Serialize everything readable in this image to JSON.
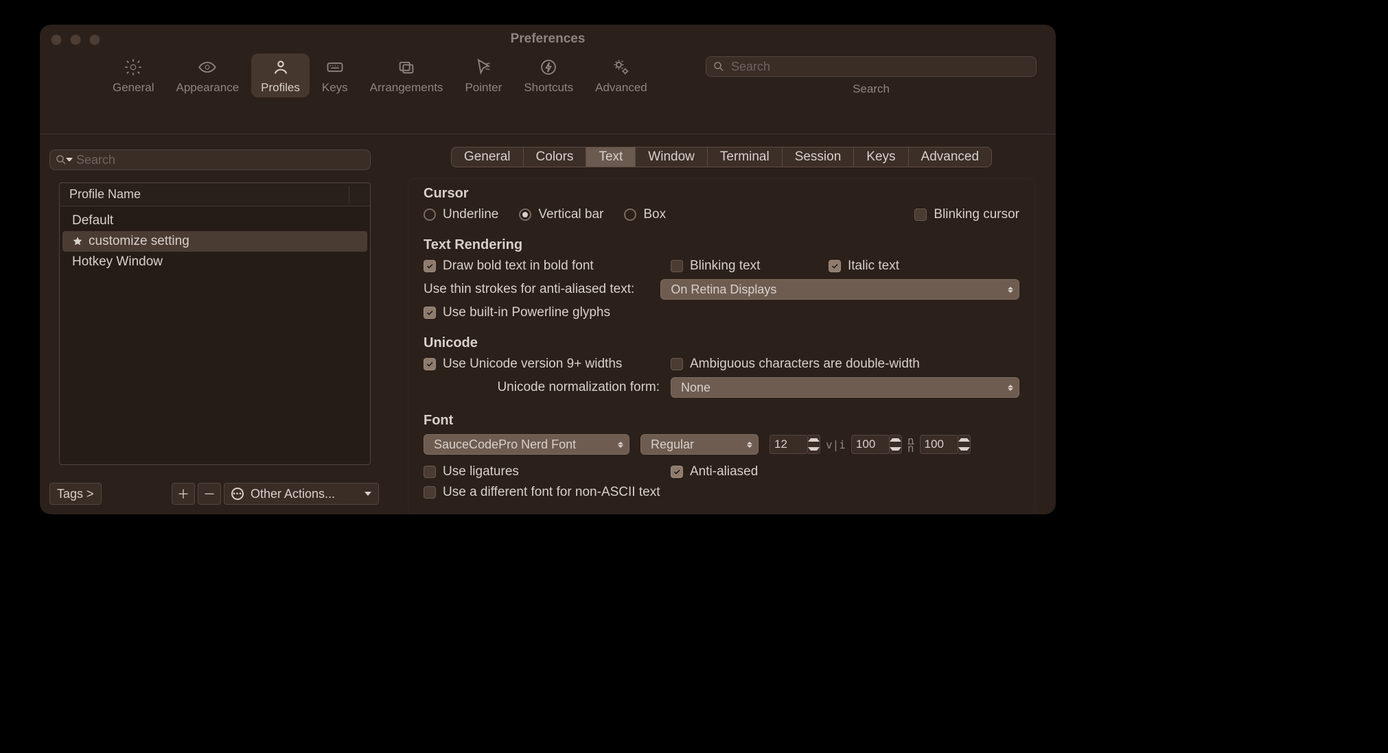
{
  "window": {
    "title": "Preferences"
  },
  "toolbar": {
    "items": [
      {
        "label": "General"
      },
      {
        "label": "Appearance"
      },
      {
        "label": "Profiles"
      },
      {
        "label": "Keys"
      },
      {
        "label": "Arrangements"
      },
      {
        "label": "Pointer"
      },
      {
        "label": "Shortcuts"
      },
      {
        "label": "Advanced"
      }
    ],
    "selected_index": 2,
    "search_placeholder": "Search",
    "search_caption": "Search"
  },
  "sidebar": {
    "search_placeholder": "Search",
    "header": "Profile Name",
    "profiles": [
      {
        "name": "Default",
        "default": false,
        "selected": false
      },
      {
        "name": "customize setting",
        "default": true,
        "selected": true
      },
      {
        "name": "Hotkey Window",
        "default": false,
        "selected": false
      }
    ],
    "tags_label": "Tags >",
    "other_actions_label": "Other Actions..."
  },
  "detail": {
    "tabs": [
      "General",
      "Colors",
      "Text",
      "Window",
      "Terminal",
      "Session",
      "Keys",
      "Advanced"
    ],
    "selected_tab_index": 2,
    "cursor": {
      "heading": "Cursor",
      "options": [
        "Underline",
        "Vertical bar",
        "Box"
      ],
      "selected_index": 1,
      "blinking_label": "Blinking cursor",
      "blinking_checked": false
    },
    "text_rendering": {
      "heading": "Text Rendering",
      "bold_label": "Draw bold text in bold font",
      "bold_checked": true,
      "blinking_text_label": "Blinking text",
      "blinking_text_checked": false,
      "italic_label": "Italic text",
      "italic_checked": true,
      "thin_strokes_label": "Use thin strokes for anti-aliased text:",
      "thin_strokes_value": "On Retina Displays",
      "powerline_label": "Use built-in Powerline glyphs",
      "powerline_checked": true
    },
    "unicode": {
      "heading": "Unicode",
      "v9_label": "Use Unicode version 9+ widths",
      "v9_checked": true,
      "ambiguous_label": "Ambiguous characters are double-width",
      "ambiguous_checked": false,
      "norm_label": "Unicode normalization form:",
      "norm_value": "None"
    },
    "font": {
      "heading": "Font",
      "family": "SauceCodePro Nerd Font",
      "weight": "Regular",
      "size": "12",
      "h_spacing": "100",
      "v_spacing": "100",
      "ligatures_label": "Use ligatures",
      "ligatures_checked": false,
      "aa_label": "Anti-aliased",
      "aa_checked": true,
      "nonascii_label": "Use a different font for non-ASCII text",
      "nonascii_checked": false
    }
  }
}
